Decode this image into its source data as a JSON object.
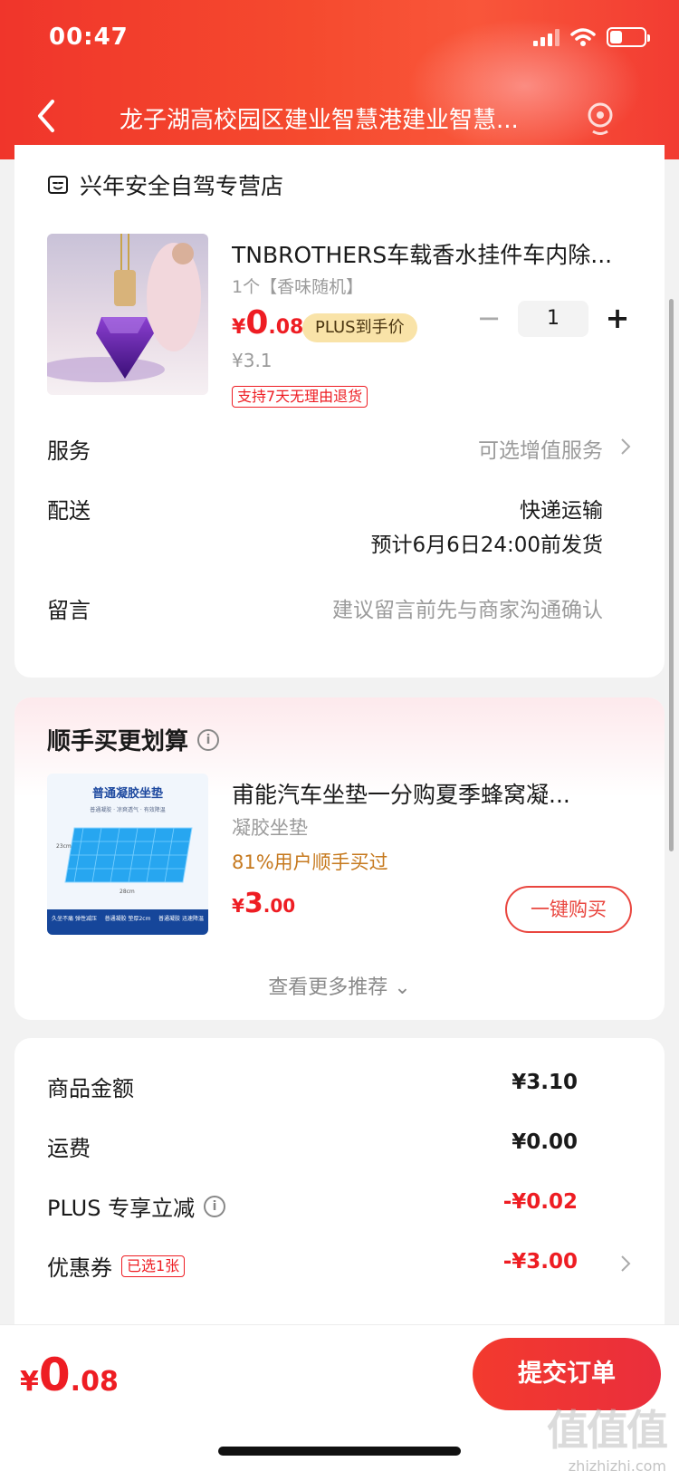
{
  "status": {
    "time": "00:47"
  },
  "nav": {
    "title": "龙子湖高校园区建业智慧港建业智慧..."
  },
  "store": {
    "name": "兴年安全自驾专营店"
  },
  "product": {
    "title": "TNBROTHERS车载香水挂件车内除...",
    "spec": "1个【香味随机】",
    "price_yen": "¥",
    "price_int": "0",
    "price_dec": ".08",
    "plus_label": "PLUS到手价",
    "original_price": "¥3.1",
    "return_tag": "支持7天无理由退货",
    "quantity": "1",
    "minus": "−",
    "plus": "+"
  },
  "service": {
    "label": "服务",
    "value": "可选增值服务"
  },
  "delivery": {
    "label": "配送",
    "method": "快递运输",
    "eta": "预计6月6日24:00前发货"
  },
  "message": {
    "label": "留言",
    "placeholder": "建议留言前先与商家沟通确认"
  },
  "recommend": {
    "title": "顺手买更划算",
    "item_name": "甫能汽车坐垫一分购夏季蜂窝凝...",
    "item_spec": "凝胶坐垫",
    "bought": "81%用户顺手买过",
    "price_yen": "¥",
    "price_int": "3",
    "price_dec": ".00",
    "buy_label": "一键购买",
    "more_label": "查看更多推荐 ⌄",
    "image_title": "普通凝胶坐垫",
    "image_sub": "普通凝胶 · 凉爽透气 · 有效降温",
    "image_dim_h": "23cm",
    "image_dim_w": "28cm",
    "image_feat1": "久坐不痛 弹性减压",
    "image_feat2": "普通凝胶 垫厚2cm",
    "image_feat3": "普通凝胶 迅速降温"
  },
  "summary": {
    "goods_label": "商品金额",
    "goods_value": "¥3.10",
    "shipping_label": "运费",
    "shipping_value": "¥0.00",
    "plus_label": "PLUS 专享立减",
    "plus_value": "-¥0.02",
    "coupon_label": "优惠券",
    "coupon_tag": "已选1张",
    "coupon_value": "-¥3.00"
  },
  "footer": {
    "total_yen": "¥",
    "total_int": "0",
    "total_dec": ".08",
    "submit_label": "提交订单"
  },
  "watermark": {
    "chars": "值值值",
    "url": "zhizhizhi.com"
  },
  "colors": {
    "accent": "#ee1d23",
    "header": "#f0352b",
    "plus_badge": "#f9e3a8",
    "bought": "#c6791e"
  }
}
